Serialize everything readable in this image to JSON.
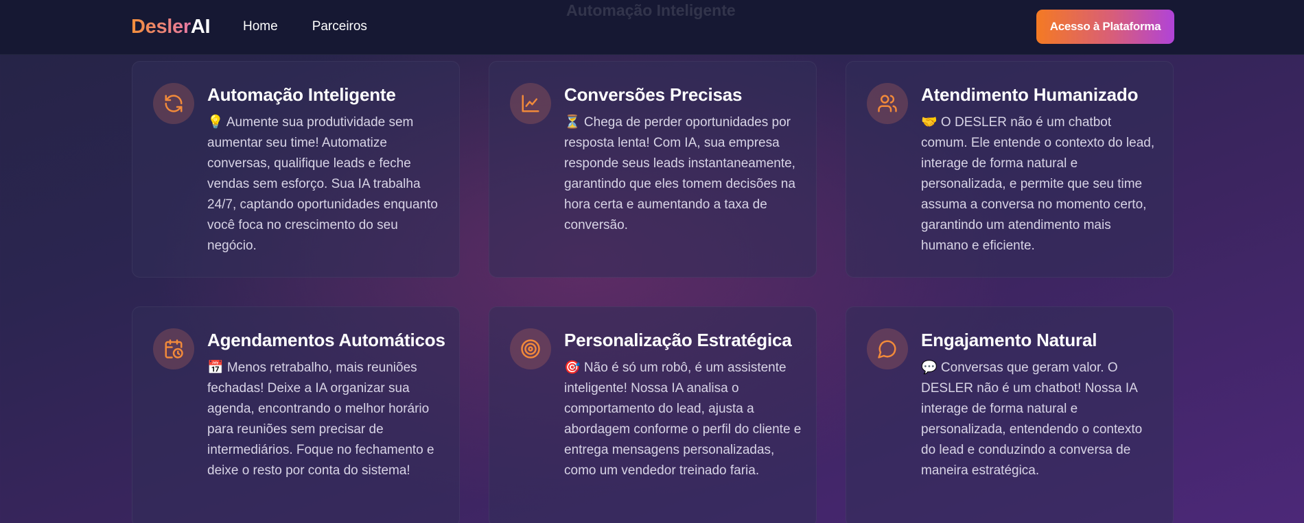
{
  "header": {
    "logo_part1": "Desler",
    "logo_part2": "AI",
    "nav": [
      "Home",
      "Parceiros"
    ],
    "cta_label": "Acesso à Plataforma",
    "ghost_title": "Automação Inteligente"
  },
  "colors": {
    "accent_orange": "#f28a3a",
    "cta_gradient_start": "#f47a23",
    "cta_gradient_end": "#b043d8",
    "header_bg": "#161833"
  },
  "cards": [
    {
      "icon": "refresh-icon",
      "title": "Automação Inteligente",
      "text": "💡 Aumente sua produtividade sem aumentar seu time! Automatize conversas, qualifique leads e feche vendas sem esforço. Sua IA trabalha 24/7, captando oportunidades enquanto você foca no crescimento do seu negócio."
    },
    {
      "icon": "line-chart-icon",
      "title": "Conversões Precisas",
      "text": "⏳ Chega de perder oportunidades por resposta lenta! Com IA, sua empresa responde seus leads instantaneamente, garantindo que eles tomem decisões na hora certa e aumentando a taxa de conversão."
    },
    {
      "icon": "users-icon",
      "title": "Atendimento Humanizado",
      "text": "🤝 O DESLER não é um chatbot comum. Ele entende o contexto do lead, interage de forma natural e personalizada, e permite que seu time assuma a conversa no momento certo, garantindo um atendimento mais humano e eficiente."
    },
    {
      "icon": "calendar-clock-icon",
      "title": "Agendamentos Automáticos",
      "text": "📅 Menos retrabalho, mais reuniões fechadas! Deixe a IA organizar sua agenda, encontrando o melhor horário para reuniões sem precisar de intermediários. Foque no fechamento e deixe o resto por conta do sistema!"
    },
    {
      "icon": "target-icon",
      "title": "Personalização Estratégica",
      "text": "🎯 Não é só um robô, é um assistente inteligente! Nossa IA analisa o comportamento do lead, ajusta a abordagem conforme o perfil do cliente e entrega mensagens personalizadas, como um vendedor treinado faria."
    },
    {
      "icon": "chat-bubble-icon",
      "title": "Engajamento Natural",
      "text": "💬 Conversas que geram valor. O DESLER não é um chatbot! Nossa IA interage de forma natural e personalizada, entendendo o contexto do lead e conduzindo a conversa de maneira estratégica."
    }
  ]
}
